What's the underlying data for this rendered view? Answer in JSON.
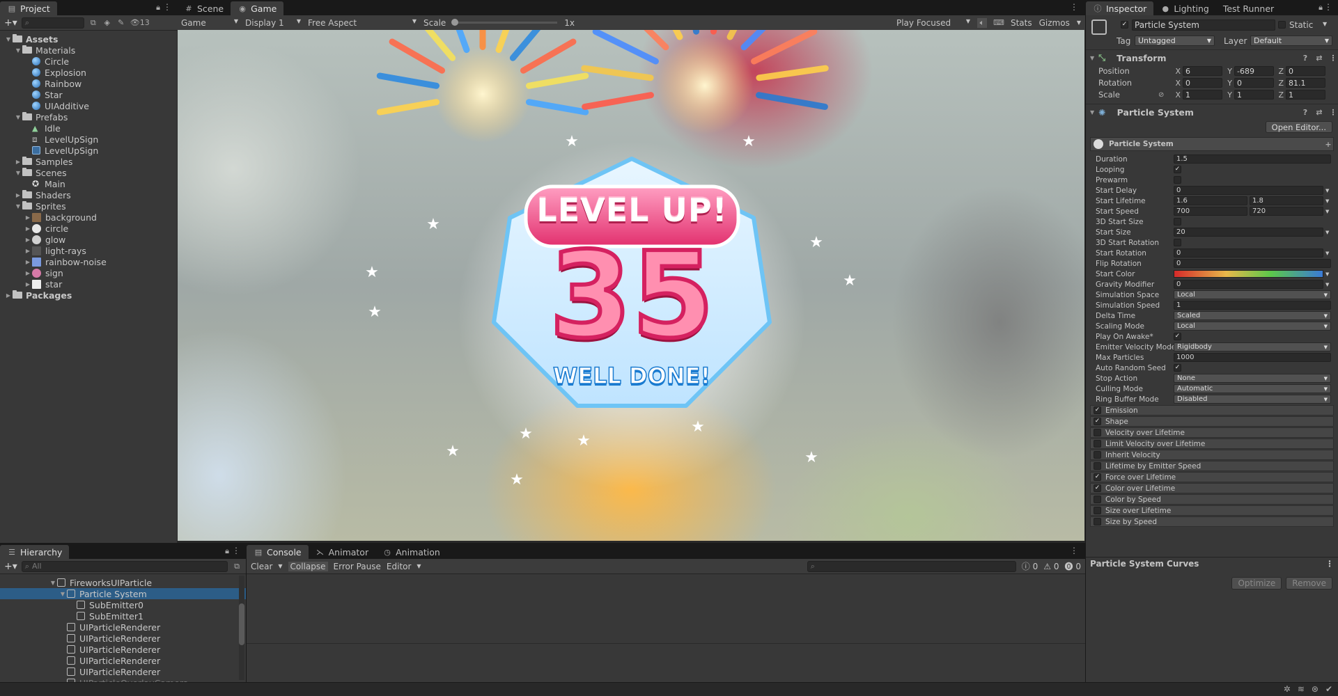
{
  "project": {
    "tab": "Project",
    "hidden_count": "13",
    "tree": [
      {
        "label": "Assets",
        "depth": 0,
        "type": "folder",
        "open": true,
        "bold": true
      },
      {
        "label": "Materials",
        "depth": 1,
        "type": "folder",
        "open": true
      },
      {
        "label": "Circle",
        "depth": 2,
        "type": "mat"
      },
      {
        "label": "Explosion",
        "depth": 2,
        "type": "mat"
      },
      {
        "label": "Rainbow",
        "depth": 2,
        "type": "mat"
      },
      {
        "label": "Star",
        "depth": 2,
        "type": "mat"
      },
      {
        "label": "UIAdditive",
        "depth": 2,
        "type": "mat"
      },
      {
        "label": "Prefabs",
        "depth": 1,
        "type": "folder",
        "open": true
      },
      {
        "label": "Idle",
        "depth": 2,
        "type": "anim"
      },
      {
        "label": "LevelUpSign",
        "depth": 2,
        "type": "prefab-var"
      },
      {
        "label": "LevelUpSign",
        "depth": 2,
        "type": "prefab"
      },
      {
        "label": "Samples",
        "depth": 1,
        "type": "folder",
        "open": false
      },
      {
        "label": "Scenes",
        "depth": 1,
        "type": "folder",
        "open": true
      },
      {
        "label": "Main",
        "depth": 2,
        "type": "scene"
      },
      {
        "label": "Shaders",
        "depth": 1,
        "type": "folder",
        "open": false
      },
      {
        "label": "Sprites",
        "depth": 1,
        "type": "folder",
        "open": true
      },
      {
        "label": "background",
        "depth": 2,
        "type": "sprite",
        "color": "#8a6a4a"
      },
      {
        "label": "circle",
        "depth": 2,
        "type": "sprite",
        "color": "#e8e8e8"
      },
      {
        "label": "glow",
        "depth": 2,
        "type": "sprite",
        "color": "#d0d0d0"
      },
      {
        "label": "light-rays",
        "depth": 2,
        "type": "sprite",
        "color": "#555"
      },
      {
        "label": "rainbow-noise",
        "depth": 2,
        "type": "sprite",
        "color": "#7a9adf"
      },
      {
        "label": "sign",
        "depth": 2,
        "type": "sprite",
        "color": "#d77aa8"
      },
      {
        "label": "star",
        "depth": 2,
        "type": "sprite",
        "color": "#eeeeee"
      },
      {
        "label": "Packages",
        "depth": 0,
        "type": "folder",
        "open": false,
        "bold": true
      }
    ]
  },
  "game": {
    "tabs": [
      "Scene",
      "Game"
    ],
    "mode": "Game",
    "display": "Display 1",
    "aspect": "Free Aspect",
    "scale_label": "Scale",
    "scale_value": "1x",
    "play_mode": "Play Focused",
    "stats": "Stats",
    "gizmos": "Gizmos",
    "banner": "LEVEL UP!",
    "level": "35",
    "subtitle": "WELL DONE!"
  },
  "inspector": {
    "tabs": [
      "Inspector",
      "Lighting",
      "Test Runner"
    ],
    "object_name": "Particle System",
    "static_label": "Static",
    "tag_label": "Tag",
    "tag_value": "Untagged",
    "layer_label": "Layer",
    "layer_value": "Default",
    "transform": {
      "title": "Transform",
      "position": {
        "label": "Position",
        "x": "6",
        "y": "-689",
        "z": "0"
      },
      "rotation": {
        "label": "Rotation",
        "x": "0",
        "y": "0",
        "z": "81.1"
      },
      "scale": {
        "label": "Scale",
        "x": "1",
        "y": "1",
        "z": "1"
      }
    },
    "ps_title": "Particle System",
    "open_editor": "Open Editor...",
    "module_header": "Particle System",
    "props": [
      {
        "label": "Duration",
        "kind": "field",
        "v": "1.5"
      },
      {
        "label": "Looping",
        "kind": "check",
        "v": true
      },
      {
        "label": "Prewarm",
        "kind": "check",
        "v": false
      },
      {
        "label": "Start Delay",
        "kind": "field",
        "v": "0",
        "arrow": true
      },
      {
        "label": "Start Lifetime",
        "kind": "pair",
        "v": "1.6",
        "v2": "1.8"
      },
      {
        "label": "Start Speed",
        "kind": "pair",
        "v": "700",
        "v2": "720"
      },
      {
        "label": "3D Start Size",
        "kind": "check",
        "v": false
      },
      {
        "label": "Start Size",
        "kind": "field",
        "v": "20",
        "arrow": true
      },
      {
        "label": "3D Start Rotation",
        "kind": "check",
        "v": false
      },
      {
        "label": "Start Rotation",
        "kind": "field",
        "v": "0",
        "arrow": true
      },
      {
        "label": "Flip Rotation",
        "kind": "field",
        "v": "0"
      },
      {
        "label": "Start Color",
        "kind": "gradient"
      },
      {
        "label": "Gravity Modifier",
        "kind": "field",
        "v": "0",
        "arrow": true
      },
      {
        "label": "Simulation Space",
        "kind": "drop",
        "v": "Local"
      },
      {
        "label": "Simulation Speed",
        "kind": "field",
        "v": "1"
      },
      {
        "label": "Delta Time",
        "kind": "drop",
        "v": "Scaled"
      },
      {
        "label": "Scaling Mode",
        "kind": "drop",
        "v": "Local"
      },
      {
        "label": "Play On Awake*",
        "kind": "check",
        "v": true
      },
      {
        "label": "Emitter Velocity Mode",
        "kind": "drop",
        "v": "Rigidbody"
      },
      {
        "label": "Max Particles",
        "kind": "field",
        "v": "1000"
      },
      {
        "label": "Auto Random Seed",
        "kind": "check",
        "v": true
      },
      {
        "label": "Stop Action",
        "kind": "drop",
        "v": "None"
      },
      {
        "label": "Culling Mode",
        "kind": "drop",
        "v": "Automatic"
      },
      {
        "label": "Ring Buffer Mode",
        "kind": "drop",
        "v": "Disabled"
      }
    ],
    "modules": [
      {
        "label": "Emission",
        "on": true
      },
      {
        "label": "Shape",
        "on": true
      },
      {
        "label": "Velocity over Lifetime",
        "on": false
      },
      {
        "label": "Limit Velocity over Lifetime",
        "on": false
      },
      {
        "label": "Inherit Velocity",
        "on": false
      },
      {
        "label": "Lifetime by Emitter Speed",
        "on": false
      },
      {
        "label": "Force over Lifetime",
        "on": true
      },
      {
        "label": "Color over Lifetime",
        "on": true
      },
      {
        "label": "Color by Speed",
        "on": false
      },
      {
        "label": "Size over Lifetime",
        "on": false
      },
      {
        "label": "Size by Speed",
        "on": false
      }
    ],
    "curves_title": "Particle System Curves",
    "optimize": "Optimize",
    "remove": "Remove"
  },
  "hierarchy": {
    "tab": "Hierarchy",
    "search_placeholder": "All",
    "items": [
      {
        "label": "FireworksUIParticle",
        "depth": 0,
        "arrow": "open"
      },
      {
        "label": "Particle System",
        "depth": 1,
        "arrow": "open",
        "selected": true
      },
      {
        "label": "SubEmitter0",
        "depth": 2
      },
      {
        "label": "SubEmitter1",
        "depth": 2
      },
      {
        "label": "UIParticleRenderer",
        "depth": 1
      },
      {
        "label": "UIParticleRenderer",
        "depth": 1
      },
      {
        "label": "UIParticleRenderer",
        "depth": 1
      },
      {
        "label": "UIParticleRenderer",
        "depth": 1
      },
      {
        "label": "UIParticleRenderer",
        "depth": 1
      },
      {
        "label": "UIParticleOverlayCamera",
        "depth": 1,
        "dim": true
      }
    ]
  },
  "console": {
    "tabs": [
      "Console",
      "Animator",
      "Animation"
    ],
    "clear": "Clear",
    "collapse": "Collapse",
    "error_pause": "Error Pause",
    "editor": "Editor",
    "log_count": "0",
    "warn_count": "0",
    "err_count": "0"
  }
}
